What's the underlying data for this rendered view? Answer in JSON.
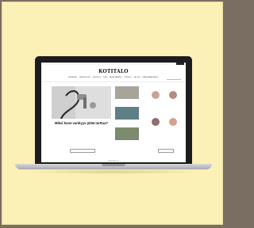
{
  "site": {
    "logo": "KOTITALO",
    "topbar_links": "",
    "nav": [
      "Asuminen",
      "Remontointi",
      "Sisustus",
      "Piha",
      "Rakentaminen",
      "Terveys",
      "Talous",
      "Energiaratkaisut"
    ],
    "hero": {
      "title": "Miksi kone vanhyys pitää tarttua?",
      "subtitle": "",
      "button": ""
    },
    "mid_items": [
      {
        "title": ""
      },
      {
        "title": ""
      },
      {
        "title": ""
      }
    ],
    "sidebar": {
      "title": "",
      "people": [
        {
          "name": ""
        },
        {
          "name": ""
        },
        {
          "name": ""
        },
        {
          "name": ""
        }
      ],
      "button": ""
    }
  },
  "device": {
    "brand": "MacBook"
  },
  "colors": {
    "background": "#fbf0b6",
    "outer": "#7a6e62",
    "laptop": "#1d1d1f"
  }
}
